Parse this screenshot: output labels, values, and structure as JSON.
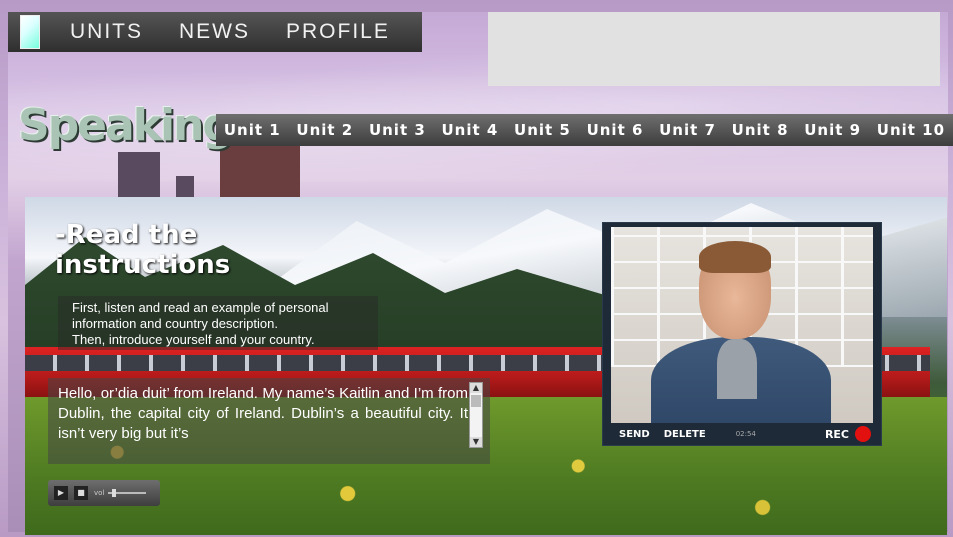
{
  "top_nav": {
    "items": [
      "UNITS",
      "NEWS",
      "PROFILE"
    ]
  },
  "page_title": "Speaking",
  "units": [
    "Unit 1",
    "Unit 2",
    "Unit 3",
    "Unit 4",
    "Unit 5",
    "Unit 6",
    "Unit 7",
    "Unit 8",
    "Unit 9",
    "Unit 10"
  ],
  "instructions": {
    "title_line1": "-Read the",
    "title_line2": "instructions",
    "line1": "First, listen and read an example of personal",
    "line2": "information and country description.",
    "line3": "Then, introduce yourself and your country."
  },
  "reading_text": "Hello, or’dia duit’ from Ireland. My name’s Kaitlin and I’m from Dublin, the capital city of Ireland. Dublin’s a beautiful city. It isn’t very big but it’s",
  "audio_player": {
    "volume_label": "vol"
  },
  "video_recorder": {
    "send_label": "SEND",
    "delete_label": "DELETE",
    "timer": "02:54",
    "rec_label": "REC",
    "rec_color": "#e31010"
  }
}
